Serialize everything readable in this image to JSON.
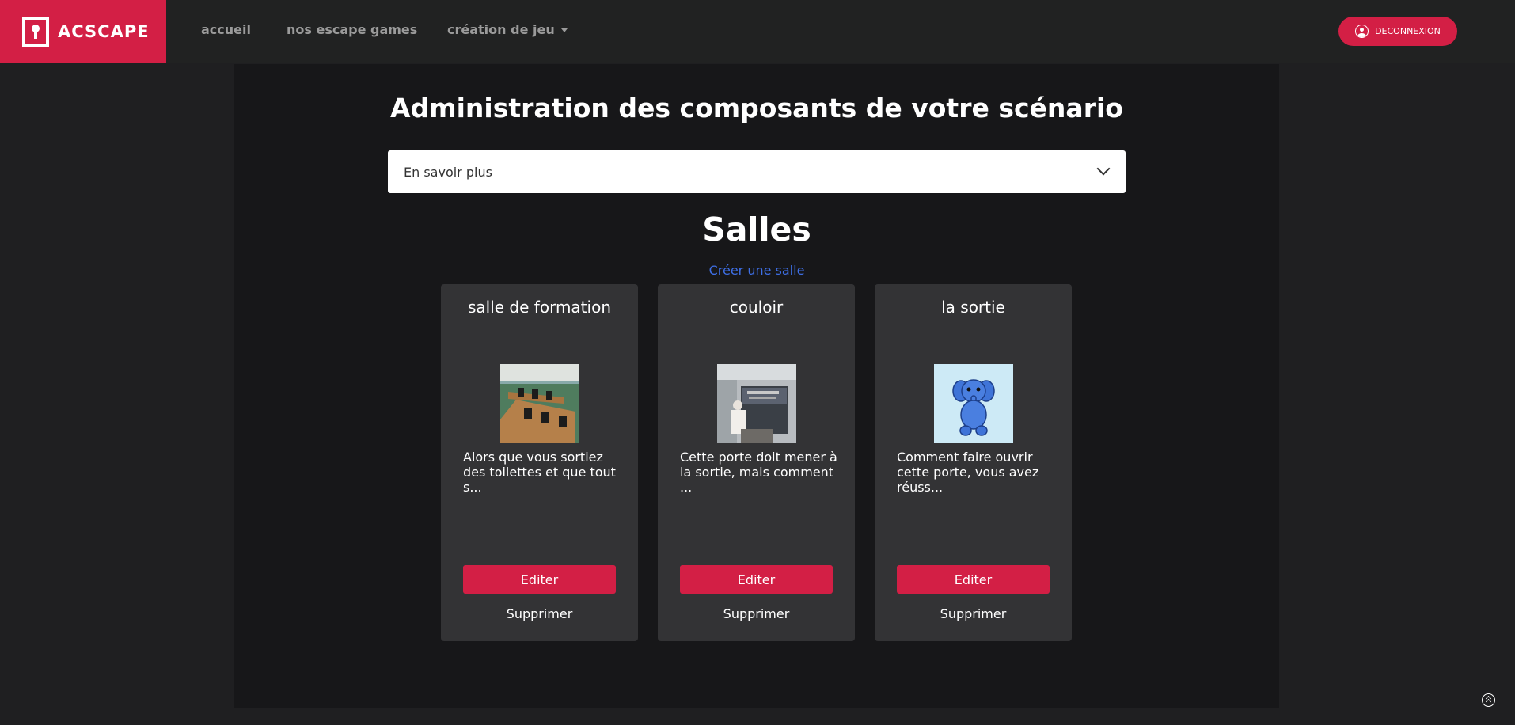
{
  "brand": {
    "name": "ACSCAPE",
    "color": "#d31f45"
  },
  "nav": {
    "links": [
      "accueil",
      "nos escape games",
      "création de jeu"
    ],
    "logout_label": "DECONNEXION"
  },
  "page": {
    "title": "Administration des composants de votre scénario",
    "dropdown_label": "En savoir plus",
    "section_title": "Salles",
    "create_link": "Créer une salle"
  },
  "rooms": [
    {
      "title": "salle de formation",
      "image": "classroom-photo",
      "description": "Alors que vous sortiez des toilettes et que tout s...",
      "edit_label": "Editer",
      "delete_label": "Supprimer"
    },
    {
      "title": "couloir",
      "image": "door-photo",
      "description": "Cette porte doit mener à la sortie, mais comment ...",
      "edit_label": "Editer",
      "delete_label": "Supprimer"
    },
    {
      "title": "la sortie",
      "image": "blue-elephant-illustration",
      "description": "Comment faire ouvrir cette porte, vous avez réuss...",
      "edit_label": "Editer",
      "delete_label": "Supprimer"
    }
  ]
}
